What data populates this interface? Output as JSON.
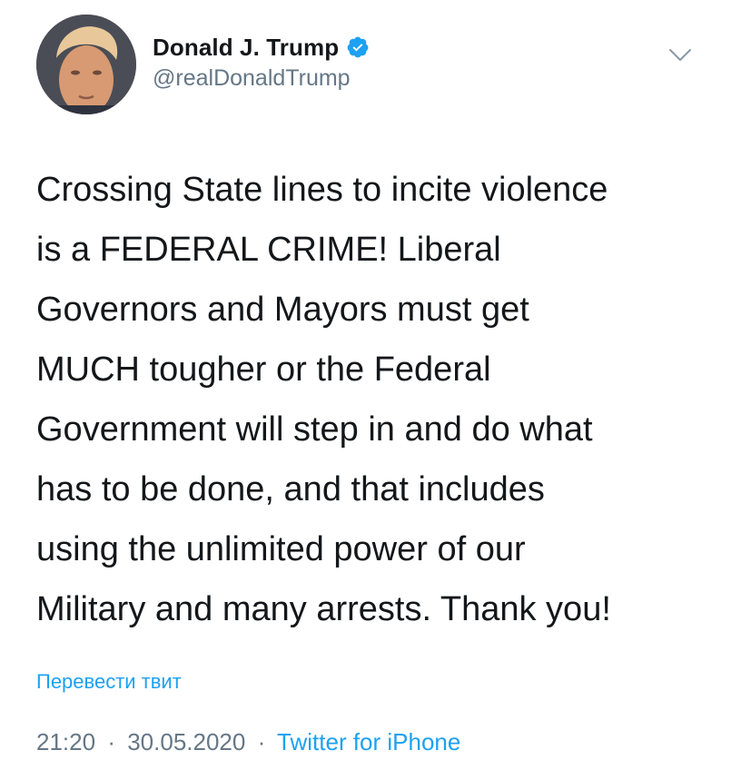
{
  "author": {
    "display_name": "Donald J. Trump",
    "handle": "@realDonaldTrump",
    "verified": true
  },
  "tweet": {
    "lines": [
      "Crossing State lines to incite violence",
      "is a FEDERAL CRIME! Liberal",
      "Governors and Mayors must get",
      "MUCH tougher or the Federal",
      "Government will step in and do what",
      "has to be done, and that includes",
      "using the unlimited power of our",
      "Military and many arrests. Thank you!"
    ],
    "translate_label": "Перевести твит",
    "time": "21:20",
    "date": "30.05.2020",
    "separator": "·",
    "source": "Twitter for iPhone"
  },
  "colors": {
    "link": "#1da1f2",
    "secondary_text": "#657786",
    "primary_text": "#14171a",
    "verified_badge": "#1da1f2"
  },
  "icons": {
    "verified": "verified-badge-icon",
    "menu": "chevron-down-icon"
  }
}
